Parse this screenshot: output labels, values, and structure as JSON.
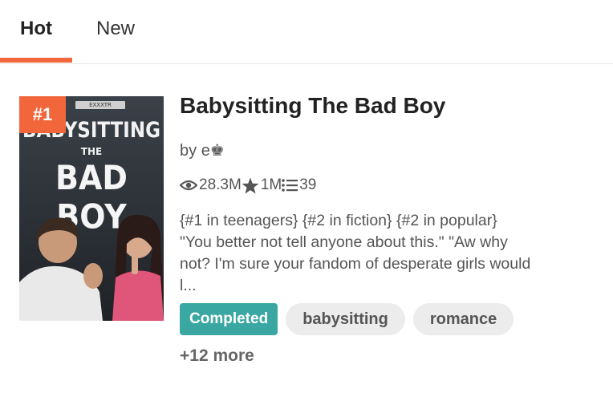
{
  "tabs": [
    {
      "label": "Hot",
      "active": true
    },
    {
      "label": "New",
      "active": false
    }
  ],
  "accent_color": "#f2663b",
  "story": {
    "rank": "#1",
    "cover": {
      "author_band": "EXXXTR",
      "title_line1": "BABYSITTING",
      "title_line2": "THE",
      "title_line3": "BAD BOY"
    },
    "title": "Babysitting The Bad Boy",
    "by_prefix": "by",
    "author": "e♚",
    "stats": {
      "reads": "28.3M",
      "votes": "1M",
      "parts": "39"
    },
    "description": "{#1 in teenagers} {#2 in fiction} {#2 in popular} \"You better not tell anyone about this.\" \"Aw why not? I'm sure your fandom of desperate girls would l...",
    "status_tag": "Completed",
    "status_color": "#3aa7a2",
    "tags": [
      "babysitting",
      "romance"
    ],
    "more_tags": "+12 more"
  }
}
